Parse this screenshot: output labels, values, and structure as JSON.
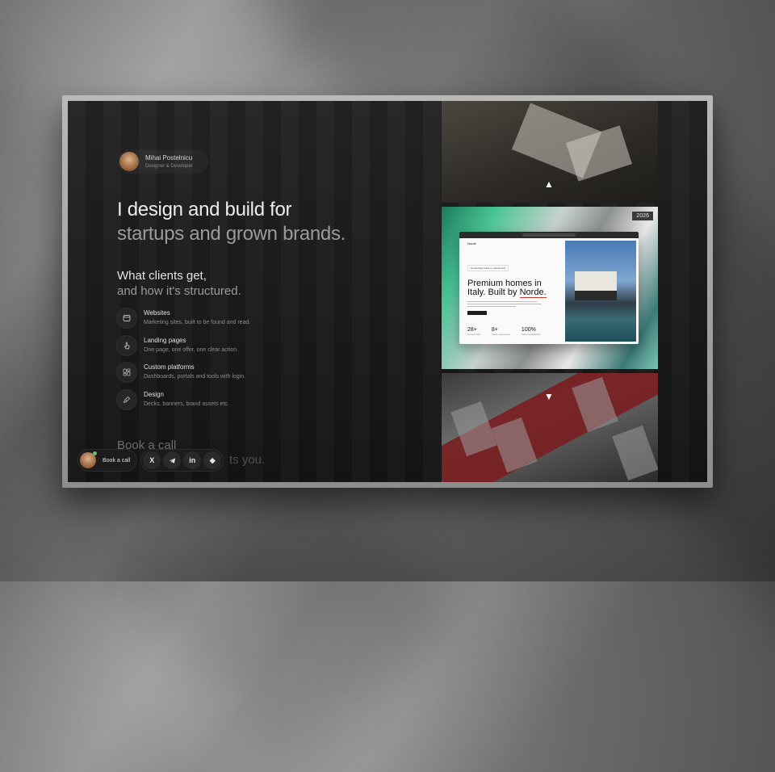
{
  "profile": {
    "name": "Mihai Postelnicu",
    "role": "Designer & Developer"
  },
  "hero": {
    "line1": "I design and build for",
    "line2": "startups and grown brands."
  },
  "section": {
    "title": "What clients get,",
    "subtitle": "and how it's structured."
  },
  "services": [
    {
      "title": "Websites",
      "desc": "Marketing sites, built to be found and read.",
      "icon": "browser-window-icon"
    },
    {
      "title": "Landing pages",
      "desc": "One page, one offer, one clear action.",
      "icon": "pointer-hand-icon"
    },
    {
      "title": "Custom platforms",
      "desc": "Dashboards, portals and tools with login.",
      "icon": "dashboard-grid-icon"
    },
    {
      "title": "Design",
      "desc": "Decks, banners, brand assets etc.",
      "icon": "pen-tool-icon"
    }
  ],
  "cta": {
    "line1": "Book a call",
    "line2_fragment": "ts you."
  },
  "dock": {
    "book_label": "Book a call",
    "social": [
      "X",
      "telegram",
      "in",
      "◆"
    ]
  },
  "showcase": {
    "year": "2026",
    "mock": {
      "brand": "Norde",
      "chip": "Handpicked villas in coastal Italy",
      "headline_l1": "Premium homes in",
      "headline_l2_prefix": "Italy. Built by ",
      "headline_brand": "Norde.",
      "stats": [
        {
          "value": "28+",
          "label": "Homes built"
        },
        {
          "value": "8+",
          "label": "Years experience"
        },
        {
          "value": "100%",
          "label": "Client Satisfaction"
        }
      ]
    }
  }
}
